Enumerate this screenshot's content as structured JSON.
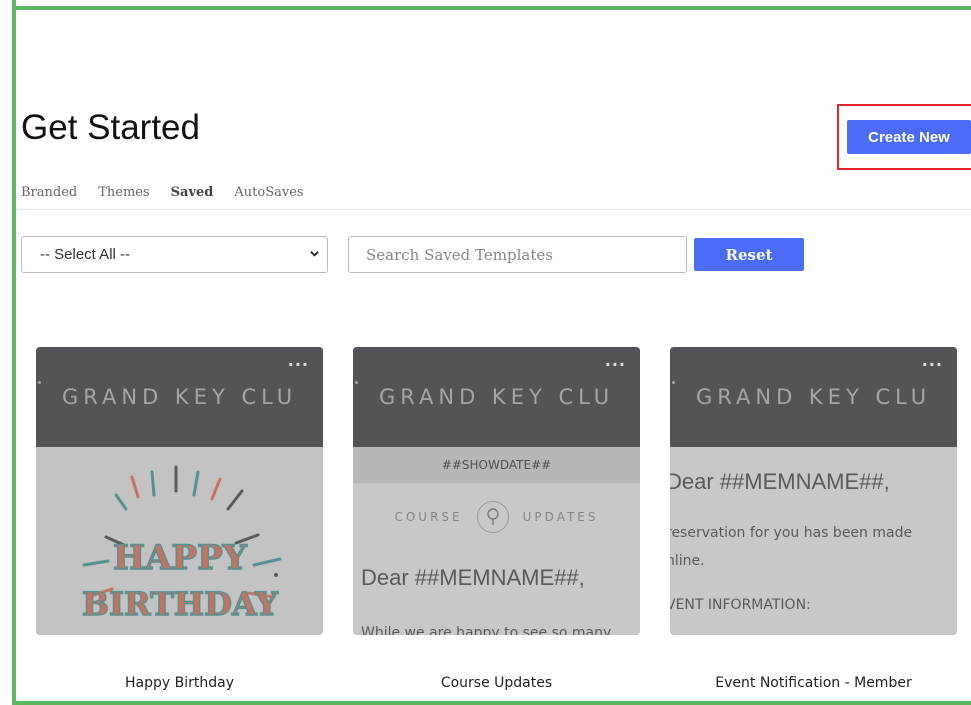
{
  "page": {
    "title": "Get Started"
  },
  "header": {
    "create_label": "Create New"
  },
  "tabs": [
    {
      "label": "Branded",
      "active": false
    },
    {
      "label": "Themes",
      "active": false
    },
    {
      "label": "Saved",
      "active": true
    },
    {
      "label": "AutoSaves",
      "active": false
    }
  ],
  "filters": {
    "select_value": "-- Select All --",
    "search_placeholder": "Search Saved Templates",
    "reset_label": "Reset"
  },
  "colors": {
    "accent": "#4a6cf7",
    "highlight": "#e0262b",
    "frame": "#5cb85c",
    "card_header": "#2a2c30"
  },
  "cards": [
    {
      "name": "Happy Birthday",
      "brand": "GRAND KEY CLU",
      "menu": "...",
      "art_line1": "HAPPY",
      "art_line2": "BIRTHDAY"
    },
    {
      "name": "Course Updates",
      "brand": "GRAND KEY CLU",
      "menu": "...",
      "showdate": "##SHOWDATE##",
      "course_left": "COURSE",
      "course_right": "UPDATES",
      "greeting": "Dear ##MEMNAME##,",
      "snippet": "While we are happy to see so many"
    },
    {
      "name": "Event Notification - Member",
      "brand": "GRAND KEY CLU",
      "menu": "...",
      "greeting": "Dear ##MEMNAME##,",
      "line1": "reservation for you has been made",
      "line2": "nline.",
      "line3": "VENT INFORMATION:"
    }
  ]
}
